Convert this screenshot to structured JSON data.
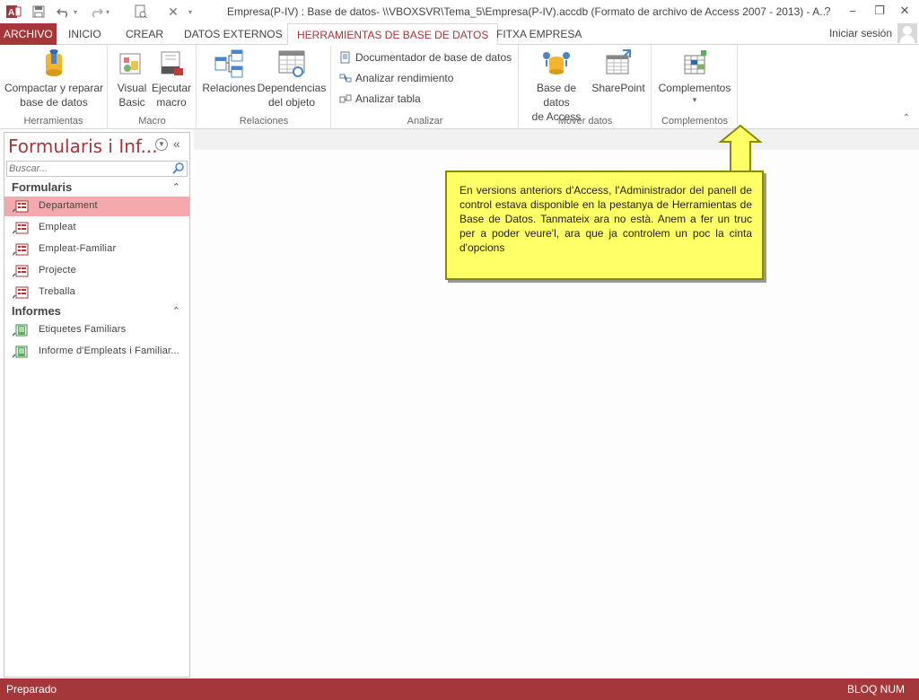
{
  "title_bar": {
    "window_title": "Empresa(P-IV) : Base de datos- \\\\VBOXSVR\\Tema_5\\Empresa(P-IV).accdb (Formato de archivo de Access 2007 - 2013) - A...",
    "help": "?",
    "minimize": "−",
    "restore": "❐",
    "close": "✕"
  },
  "tabs": {
    "file": "ARCHIVO",
    "home": "INICIO",
    "create": "CREAR",
    "external": "DATOS EXTERNOS",
    "dbtools": "HERRAMIENTAS DE BASE DE DATOS",
    "fitxa": "FITXA EMPRESA",
    "signin": "Iniciar sesión"
  },
  "ribbon": {
    "groups": {
      "tools": "Herramientas",
      "macro": "Macro",
      "relations": "Relaciones",
      "analyze": "Analizar",
      "move": "Mover datos",
      "addins": "Complementos"
    },
    "buttons": {
      "compact_1": "Compactar y reparar",
      "compact_2": "base de datos",
      "vb_1": "Visual",
      "vb_2": "Basic",
      "run_1": "Ejecutar",
      "run_2": "macro",
      "relations": "Relaciones",
      "deps_1": "Dependencias",
      "deps_2": "del objeto",
      "documenter": "Documentador de base de datos",
      "perf": "Analizar rendimiento",
      "table": "Analizar tabla",
      "access_1": "Base de datos",
      "access_2": "de Access",
      "sharepoint": "SharePoint",
      "addins": "Complementos",
      "addins_arrow": "▾"
    }
  },
  "nav": {
    "title": "Formularis i Inf...",
    "search_placeholder": "Buscar...",
    "sections": [
      {
        "label": "Formularis",
        "items": [
          "Departament",
          "Empleat",
          "Empleat-Familiar",
          "Projecte",
          "Treballa"
        ]
      },
      {
        "label": "Informes",
        "items": [
          "Etiquetes Familiars",
          "Informe d'Empleats i Familiar..."
        ]
      }
    ]
  },
  "callout": {
    "text": "En versions anteriors d'Access, l'Administrador del panell de control estava disponible en la pestanya de Herramientas de Base de Datos. Tanmateix ara no està. Anem a fer un truc per a poder veure'l, ara que ja controlem un poc la cinta d'opcions"
  },
  "status": {
    "left": "Preparado",
    "right": "BLOQ NUM"
  },
  "colors": {
    "accent": "#a4373a",
    "selected_item": "#f4a9ad",
    "callout": "#ffff66"
  }
}
